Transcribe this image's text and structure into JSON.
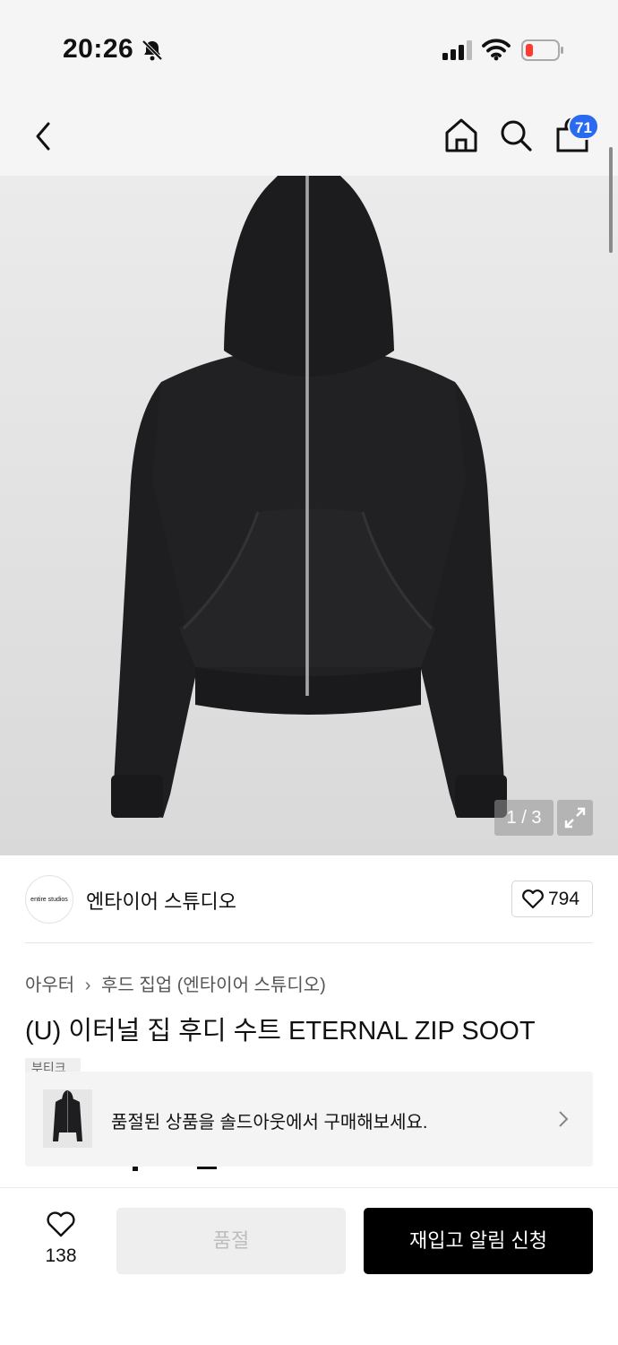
{
  "status_bar": {
    "time": "20:26"
  },
  "nav": {
    "cart_count": "71"
  },
  "gallery": {
    "counter": "1 / 3"
  },
  "brand": {
    "logo_text": "entire studios",
    "name": "엔타이어 스튜디오",
    "like_count": "794"
  },
  "breadcrumb": {
    "category": "아우터",
    "subcategory": "후드 집업 (엔타이어 스튜디오)"
  },
  "product": {
    "title": "(U) 이터널 집 후디 수트 ETERNAL ZIP SOOT",
    "tag": "부티크"
  },
  "soldout_banner": {
    "text": "품절된 상품을 솔드아웃에서 구매해보세요."
  },
  "bottom_bar": {
    "wish_count": "138",
    "soldout_label": "품절",
    "notify_label": "재입고 알림 신청"
  },
  "colors": {
    "accent_badge": "#2a6af0",
    "battery_low": "#ff3b30",
    "primary_button": "#000000"
  }
}
